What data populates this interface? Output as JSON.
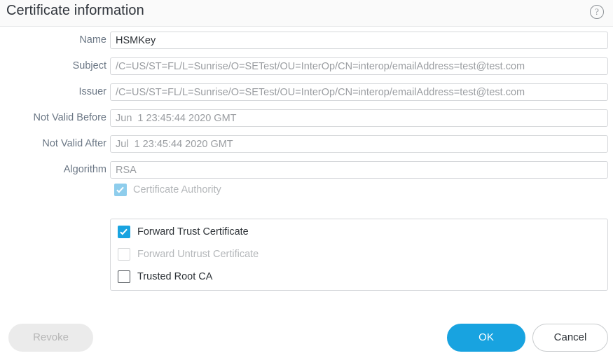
{
  "header": {
    "title": "Certificate information",
    "help_icon": "question-mark-circle-icon",
    "help_glyph": "?"
  },
  "form": {
    "fields": [
      {
        "label": "Name",
        "value": "HSMKey",
        "editable": true
      },
      {
        "label": "Subject",
        "value": "/C=US/ST=FL/L=Sunrise/O=SETest/OU=InterOp/CN=interop/emailAddress=test@test.com",
        "editable": false
      },
      {
        "label": "Issuer",
        "value": "/C=US/ST=FL/L=Sunrise/O=SETest/OU=InterOp/CN=interop/emailAddress=test@test.com",
        "editable": false
      },
      {
        "label": "Not Valid Before",
        "value": "Jun  1 23:45:44 2020 GMT",
        "editable": false
      },
      {
        "label": "Not Valid After",
        "value": "Jul  1 23:45:44 2020 GMT",
        "editable": false
      },
      {
        "label": "Algorithm",
        "value": "RSA",
        "editable": false
      }
    ]
  },
  "certificate_authority": {
    "label": "Certificate Authority",
    "checked": true,
    "disabled": true
  },
  "usage_group": {
    "options": [
      {
        "label": "Forward Trust Certificate",
        "checked": true,
        "disabled": false
      },
      {
        "label": "Forward Untrust Certificate",
        "checked": false,
        "disabled": true
      },
      {
        "label": "Trusted Root CA",
        "checked": false,
        "disabled": false
      }
    ]
  },
  "footer": {
    "revoke_label": "Revoke",
    "revoke_disabled": true,
    "ok_label": "OK",
    "cancel_label": "Cancel"
  },
  "colors": {
    "accent": "#18a3e0",
    "accent_disabled": "#8ecdec",
    "header_bg": "#fafafa",
    "label_text": "#6b7785",
    "value_text": "#9a9da1",
    "value_text_editable": "#2e3338",
    "border": "#d5d7da",
    "disabled_text": "#b4b7ba",
    "revoke_bg": "#ebebeb"
  }
}
